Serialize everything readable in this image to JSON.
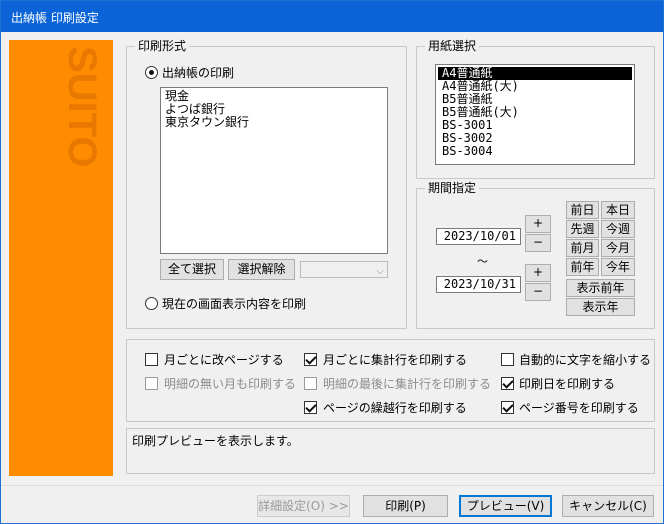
{
  "window": {
    "title": "出納帳 印刷設定"
  },
  "sidebar": {
    "brand": "SUITO",
    "color": "#ff8c00"
  },
  "print_format": {
    "legend": "印刷形式",
    "radio_ledger": "出納帳の印刷",
    "accounts": [
      "現金",
      "よつば銀行",
      "東京タウン銀行"
    ],
    "select_all": "全て選択",
    "deselect": "選択解除",
    "combo_value": "",
    "radio_screen": "現在の画面表示内容を印刷"
  },
  "paper": {
    "legend": "用紙選択",
    "items": [
      "A4普通紙",
      "A4普通紙(大)",
      "B5普通紙",
      "B5普通紙(大)",
      "BS-3001",
      "BS-3002",
      "BS-3004"
    ],
    "selected": "A4普通紙"
  },
  "period": {
    "legend": "期間指定",
    "start": "2023/10/01",
    "end": "2023/10/31",
    "tilde": "～",
    "plus": "+",
    "minus": "−",
    "btn_prev_day": "前日",
    "btn_today": "本日",
    "btn_prev_week": "先週",
    "btn_this_week": "今週",
    "btn_prev_month": "前月",
    "btn_this_month": "今月",
    "btn_prev_year": "前年",
    "btn_this_year": "今年",
    "btn_prev_display_year": "表示前年",
    "btn_display_year": "表示年"
  },
  "options": {
    "page_break_monthly": "月ごとに改ページする",
    "print_empty_months": "明細の無い月も印刷する",
    "monthly_total": "月ごとに集計行を印刷する",
    "total_at_end": "明細の最後に集計行を印刷する",
    "carryover": "ページの繰越行を印刷する",
    "shrink_text": "自動的に文字を縮小する",
    "print_date": "印刷日を印刷する",
    "page_number": "ページ番号を印刷する"
  },
  "status": {
    "message": "印刷プレビューを表示します。"
  },
  "footer": {
    "details": "詳細設定(O) >>",
    "print": "印刷(P)",
    "preview": "プレビュー(V)",
    "cancel": "キャンセル(C)"
  }
}
